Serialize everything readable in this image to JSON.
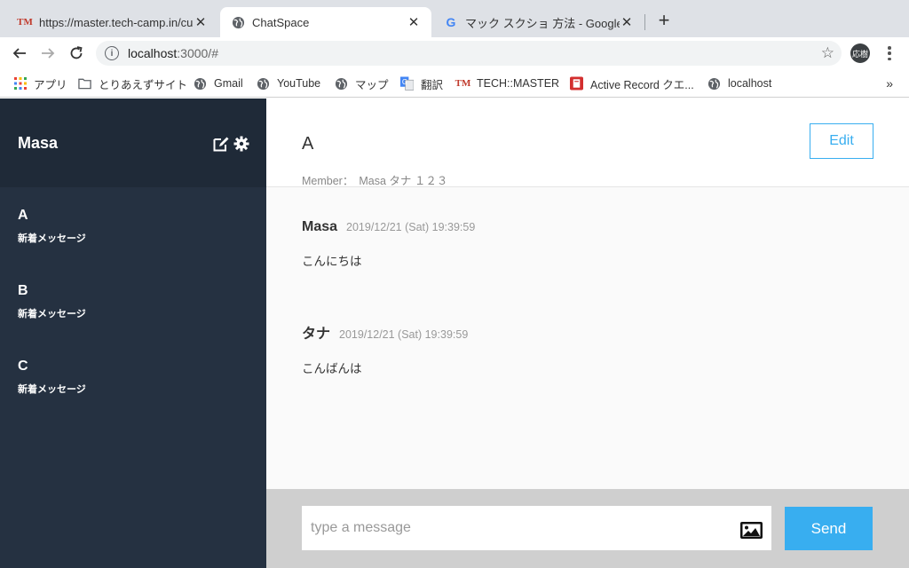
{
  "browser": {
    "tabs": [
      {
        "title": "https://master.tech-camp.in/cu",
        "favicon": "TM",
        "close": "✕"
      },
      {
        "title": "ChatSpace",
        "favicon": "globe-icon",
        "close": "✕"
      },
      {
        "title": "マック スクショ 方法 - Google 検",
        "favicon": "G",
        "close": "✕"
      }
    ],
    "new_tab": "+",
    "url_host": "localhost",
    "url_path": ":3000/#",
    "profile_label": "応樹",
    "bookmarks": [
      {
        "label": "アプリ",
        "icon": "apps-grid-icon"
      },
      {
        "label": "とりあえずサイト",
        "icon": "folder-icon"
      },
      {
        "label": "Gmail",
        "icon": "globe-icon"
      },
      {
        "label": "YouTube",
        "icon": "globe-icon"
      },
      {
        "label": "マップ",
        "icon": "globe-icon"
      },
      {
        "label": "翻訳",
        "icon": "translate-icon"
      },
      {
        "label": "TECH::MASTER",
        "icon": "TM"
      },
      {
        "label": "Active Record クエ...",
        "icon": "red-book-icon"
      },
      {
        "label": "localhost",
        "icon": "globe-icon"
      }
    ],
    "bookmarks_more": "»"
  },
  "sidebar": {
    "user_name": "Masa",
    "groups": [
      {
        "name": "A",
        "latest": "新着メッセージ"
      },
      {
        "name": "B",
        "latest": "新着メッセージ"
      },
      {
        "name": "C",
        "latest": "新着メッセージ"
      }
    ]
  },
  "main": {
    "group_name": "A",
    "member_label": "Member：",
    "members": "Masa タナ １２３",
    "edit_label": "Edit",
    "messages": [
      {
        "sender": "Masa",
        "date": "2019/12/21 (Sat) 19:39:59",
        "text": "こんにちは"
      },
      {
        "sender": "タナ",
        "date": "2019/12/21 (Sat) 19:39:59",
        "text": "こんばんは"
      }
    ],
    "input_placeholder": "type a message",
    "send_label": "Send"
  },
  "colors": {
    "sidebar_bg": "#253141",
    "sidebar_header_bg": "#1f2a38",
    "accent": "#38aef0",
    "form_bg": "#cfcfcf"
  }
}
